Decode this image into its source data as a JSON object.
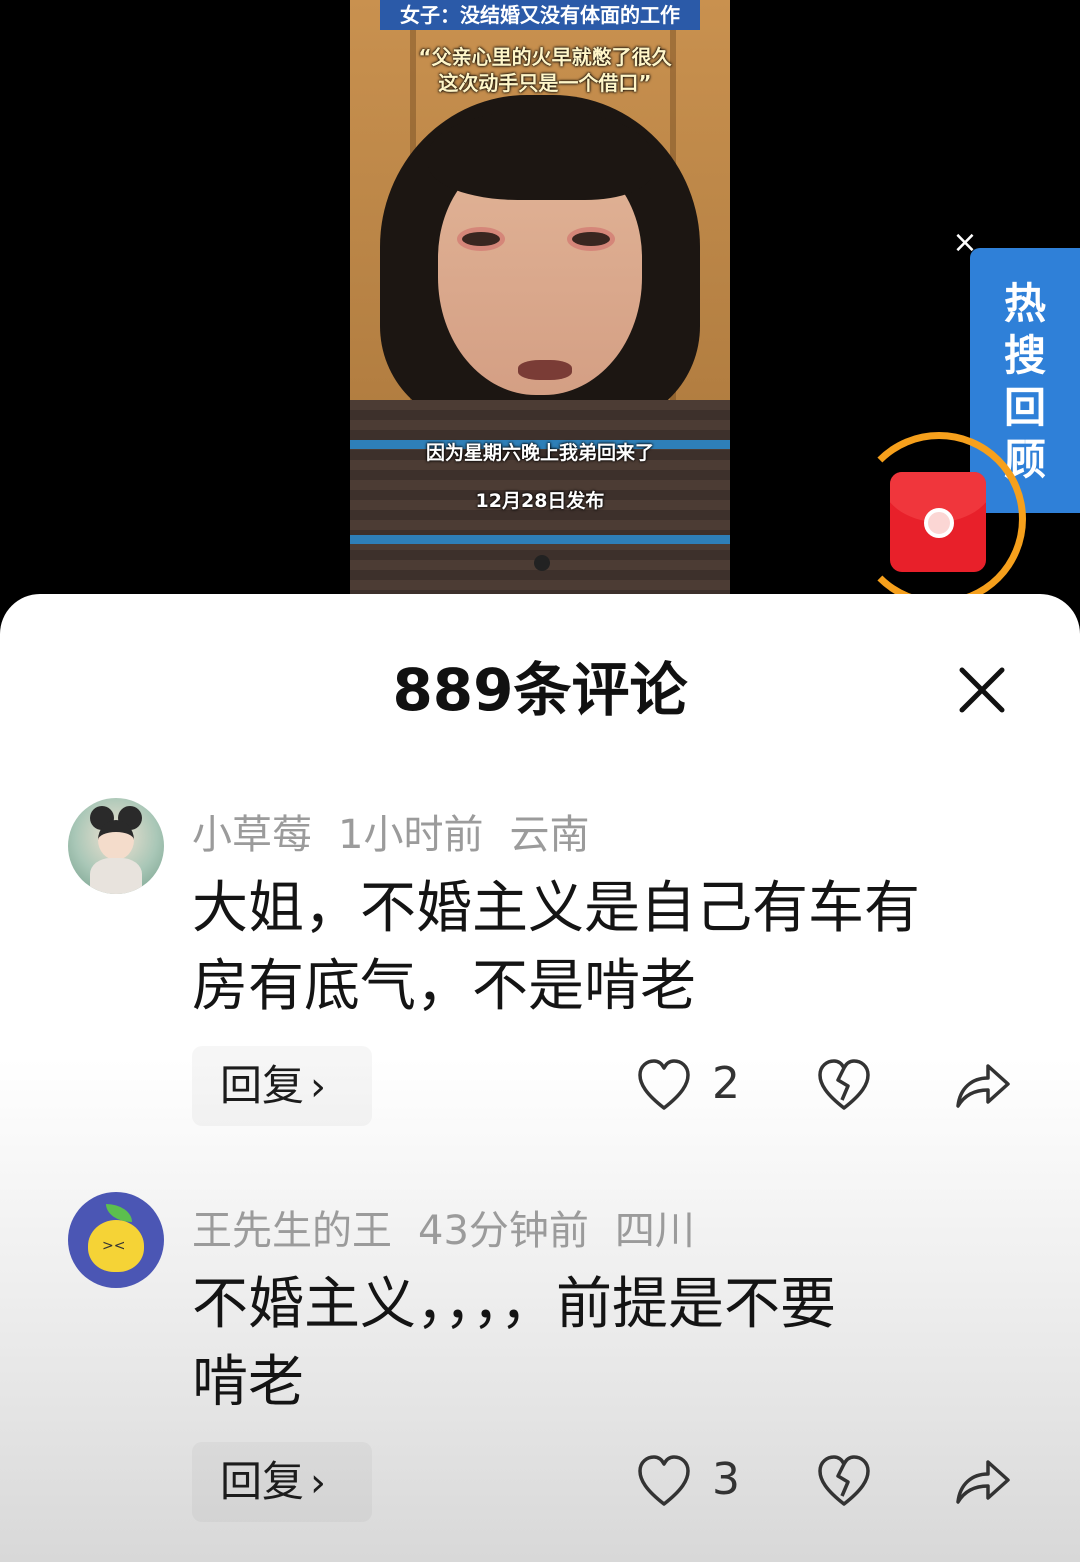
{
  "video": {
    "title": "女子：没结婚又没有体面的工作",
    "quote_line1": "“父亲心里的火早就憋了很久",
    "quote_line2": "这次动手只是一个借口”",
    "caption": "因为星期六晚上我弟回来了",
    "date": "12月28日发布"
  },
  "hot_search": {
    "close": "×",
    "chars": [
      "热",
      "搜",
      "回",
      "顾"
    ]
  },
  "comments_header": {
    "title": "889条评论"
  },
  "comments": [
    {
      "user": "小草莓",
      "time": "1小时前",
      "location": "云南",
      "text_line1": "大姐，不婚主义是自己有车有",
      "text_line2": "房有底气，不是啃老",
      "reply_label": "回复",
      "likes": "2"
    },
    {
      "user": "王先生的王",
      "time": "43分钟前",
      "location": "四川",
      "text_line1": "不婚主义，，，，前提是不要",
      "text_line2": "啃老",
      "reply_label": "回复",
      "likes": "3"
    }
  ],
  "icons": {
    "close": "close-icon",
    "like": "heart-icon",
    "dislike": "broken-heart-icon",
    "share": "share-icon",
    "envelope": "red-envelope-icon"
  },
  "colors": {
    "hot_tab": "#2f80d8",
    "envelope": "#e8202a",
    "ring": "#f6a01c",
    "title_bar": "#2b5aa8"
  }
}
